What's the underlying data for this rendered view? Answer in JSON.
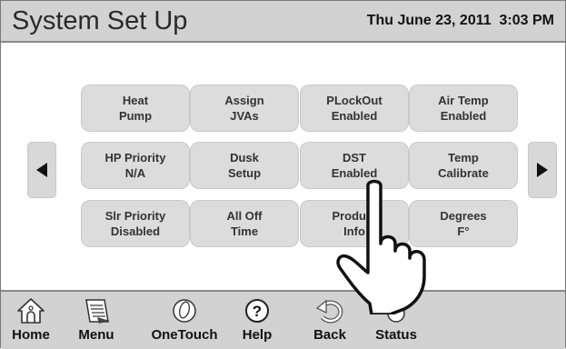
{
  "header": {
    "title": "System Set Up",
    "datetime": "Thu June 23, 2011  3:03 PM"
  },
  "grid": [
    {
      "line1": "Heat",
      "line2": "Pump"
    },
    {
      "line1": "Assign",
      "line2": "JVAs"
    },
    {
      "line1": "PLockOut",
      "line2": "Enabled"
    },
    {
      "line1": "Air Temp",
      "line2": "Enabled"
    },
    {
      "line1": "HP Priority",
      "line2": "N/A"
    },
    {
      "line1": "Dusk",
      "line2": "Setup"
    },
    {
      "line1": "DST",
      "line2": "Enabled"
    },
    {
      "line1": "Temp",
      "line2": "Calibrate"
    },
    {
      "line1": "Slr Priority",
      "line2": "Disabled"
    },
    {
      "line1": "All Off",
      "line2": "Time"
    },
    {
      "line1": "Product",
      "line2": "Info"
    },
    {
      "line1": "Degrees",
      "line2": "F°"
    }
  ],
  "nav": {
    "left_icon": "triangle-left",
    "right_icon": "triangle-right"
  },
  "toolbar": [
    {
      "label": "Home",
      "icon": "house"
    },
    {
      "label": "Menu",
      "icon": "document"
    },
    {
      "label": "OneTouch",
      "icon": "finger-button"
    },
    {
      "label": "Help",
      "icon": "question-circle"
    },
    {
      "label": "Back",
      "icon": "curved-arrow"
    },
    {
      "label": "Status",
      "icon": "status-dot"
    }
  ],
  "colors": {
    "bar_background": "#d2d2d2",
    "button_background": "#dcdcdc",
    "text": "#333333"
  }
}
